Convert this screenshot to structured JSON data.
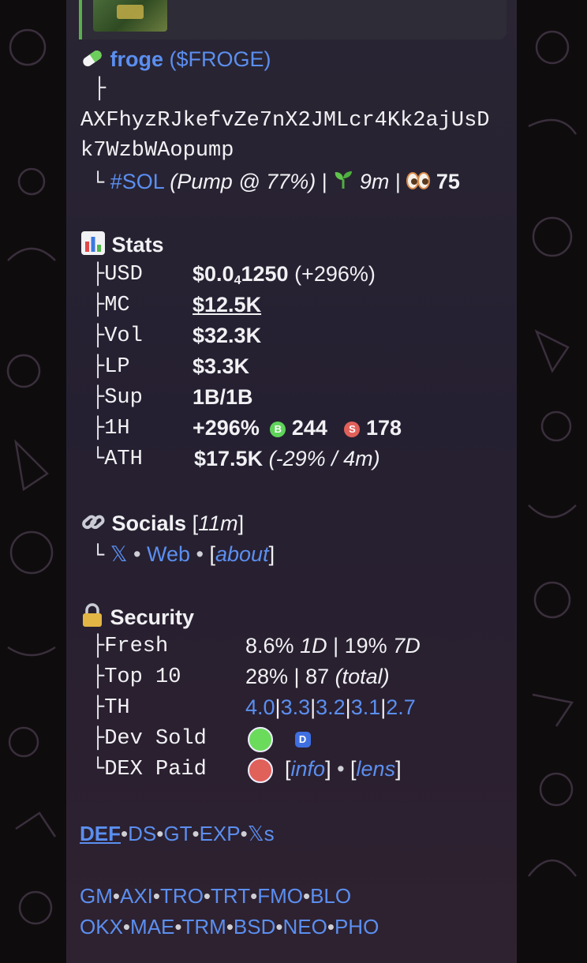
{
  "token": {
    "name": "froge",
    "ticker": "($FROGE)",
    "address_line1": "AXFhyzRJkefvZe7nX2JMLcr4Kk2ajUsD",
    "address_line2": "k7WzbWAopump",
    "chain": "#SOL",
    "pump": "(Pump @ 77%)",
    "age": "9m",
    "eyes": "75"
  },
  "stats": {
    "title": "Stats",
    "rows": [
      {
        "label": "USD",
        "value": "$0.0₄1250",
        "extra": "(+296%)"
      },
      {
        "label": "MC",
        "value": "$12.5K"
      },
      {
        "label": "Vol",
        "value": "$32.3K"
      },
      {
        "label": "LP",
        "value": "$3.3K"
      },
      {
        "label": "Sup",
        "value": "1B/1B"
      },
      {
        "label": "1H",
        "value": "+296%",
        "buys_badge": "B",
        "buys": "244",
        "sells_badge": "S",
        "sells": "178"
      },
      {
        "label": "ATH",
        "value": "$17.5K",
        "extra": "(-29% / 4m)"
      }
    ]
  },
  "socials": {
    "title": "Socials",
    "age": "11m",
    "x_link": "𝕏",
    "web_link": "Web",
    "about_link": "about"
  },
  "security": {
    "title": "Security",
    "rows": [
      {
        "label": "Fresh",
        "v1": "8.6%",
        "p1": "1D",
        "v2": "19%",
        "p2": "7D"
      },
      {
        "label": "Top 10",
        "v1": "28%",
        "v2": "87",
        "p2": "(total)"
      },
      {
        "label": "TH",
        "links": [
          "4.0",
          "3.3",
          "3.2",
          "3.1",
          "2.7"
        ]
      },
      {
        "label": "Dev Sold",
        "badge": "D"
      },
      {
        "label": "DEX Paid",
        "info": "info",
        "lens": "lens"
      }
    ]
  },
  "links_row1": [
    "DEF",
    "DS",
    "GT",
    "EXP",
    "𝕏s"
  ],
  "links_row2": [
    "GM",
    "AXI",
    "TRO",
    "TRT",
    "FMO",
    "BLO"
  ],
  "links_row3": [
    "OKX",
    "MAE",
    "TRM",
    "BSD",
    "NEO",
    "PHO"
  ],
  "colors": {
    "link": "#5b8ff0",
    "green": "#5fd35a",
    "red": "#e0605a",
    "bubble": "#262131"
  },
  "icons": [
    "pill-icon",
    "seedling-icon",
    "eyes-icon",
    "bar-chart-icon",
    "link-icon",
    "lock-icon",
    "buy-badge-icon",
    "sell-badge-icon"
  ]
}
